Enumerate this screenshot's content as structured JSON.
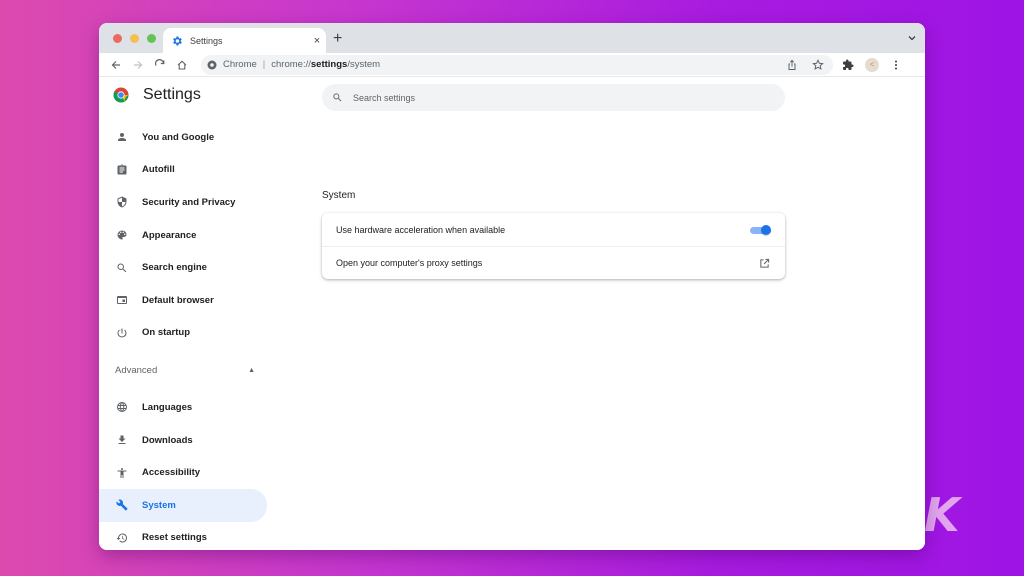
{
  "window": {
    "tab": {
      "title": "Settings",
      "icon": "gear-icon"
    },
    "new_tab_label": "+",
    "close_tab_label": "×"
  },
  "toolbar": {
    "site_label": "Chrome",
    "url_prefix": "chrome://",
    "url_bold": "settings",
    "url_suffix": "/system",
    "profile_initial": "<"
  },
  "sidebar": {
    "title": "Settings",
    "items": [
      {
        "label": "You and Google",
        "icon": "person-icon"
      },
      {
        "label": "Autofill",
        "icon": "clipboard-icon"
      },
      {
        "label": "Security and Privacy",
        "icon": "shield-icon"
      },
      {
        "label": "Appearance",
        "icon": "palette-icon"
      },
      {
        "label": "Search engine",
        "icon": "search-icon"
      },
      {
        "label": "Default browser",
        "icon": "browser-icon"
      },
      {
        "label": "On startup",
        "icon": "power-icon"
      }
    ],
    "advanced_label": "Advanced",
    "advanced_items": [
      {
        "label": "Languages",
        "icon": "globe-icon"
      },
      {
        "label": "Downloads",
        "icon": "download-icon"
      },
      {
        "label": "Accessibility",
        "icon": "accessibility-icon"
      },
      {
        "label": "System",
        "icon": "wrench-icon",
        "active": true
      },
      {
        "label": "Reset settings",
        "icon": "history-icon"
      }
    ]
  },
  "main": {
    "search_placeholder": "Search settings",
    "section_title": "System",
    "rows": [
      {
        "label": "Use hardware acceleration when available",
        "control": "toggle",
        "checked": true
      },
      {
        "label": "Open your computer's proxy settings",
        "control": "external-link"
      }
    ]
  },
  "colors": {
    "accent": "#1a73e8",
    "active_bg": "#e8f0fe",
    "toggle_track": "#8ab4f8"
  },
  "watermark": "K"
}
